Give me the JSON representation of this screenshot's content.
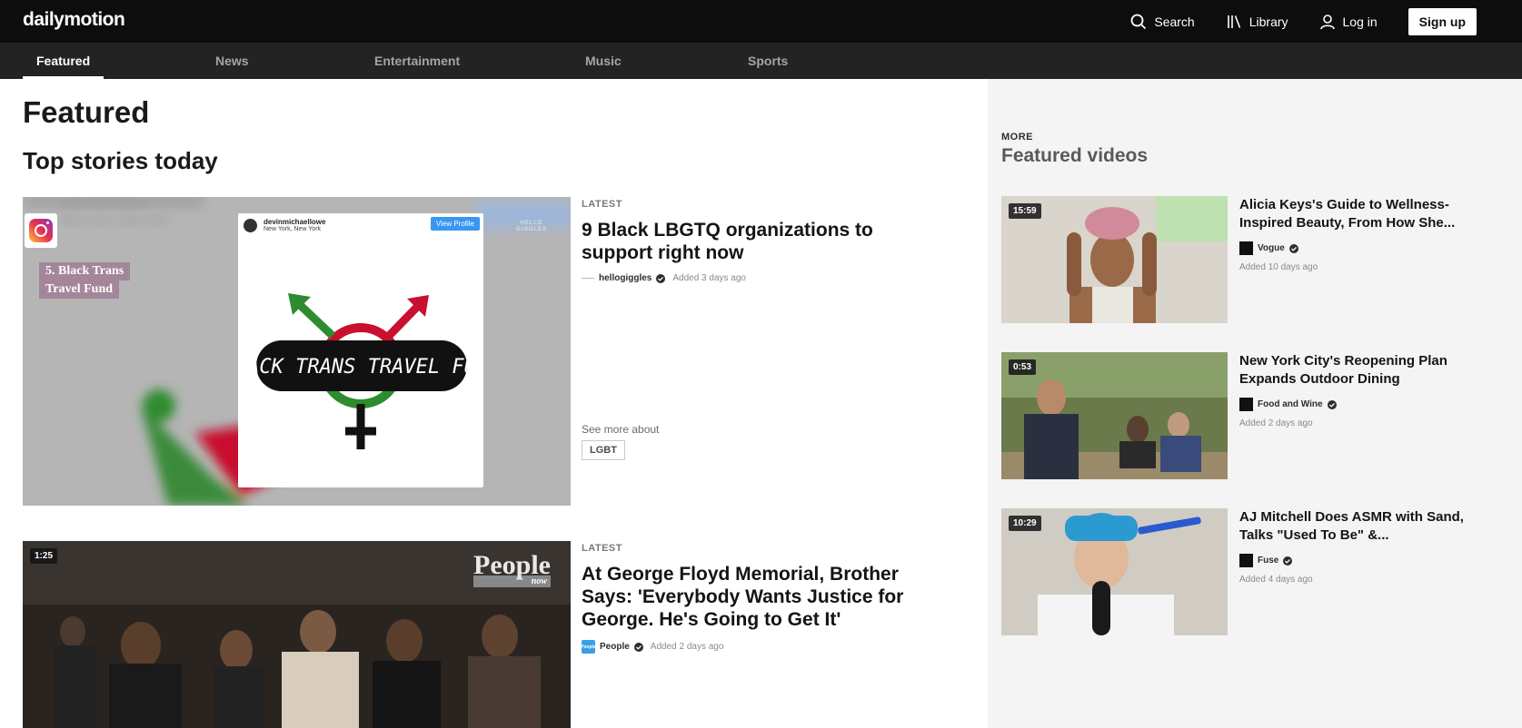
{
  "app": {
    "logo": "dailymotion"
  },
  "header": {
    "search_label": "Search",
    "library_label": "Library",
    "login_label": "Log in",
    "signup_label": "Sign up"
  },
  "nav": {
    "tabs": [
      {
        "label": "Featured",
        "active": true
      },
      {
        "label": "News"
      },
      {
        "label": "Entertainment"
      },
      {
        "label": "Music"
      },
      {
        "label": "Sports"
      }
    ]
  },
  "main": {
    "page_title": "Featured",
    "section_title": "Top stories today",
    "stories": [
      {
        "eyebrow": "LATEST",
        "title": "9 Black LBGTQ organizations to support right now",
        "channel": "hellogiggles",
        "added": "Added 3 days ago",
        "see_more": "See more about",
        "tag": "LGBT",
        "thumb": {
          "caption_line1": "5. Black Trans",
          "caption_line2": "Travel Fund",
          "profile_name": "devinmichaellowe",
          "profile_location": "New York, New York",
          "view_profile": "View Profile",
          "sticker_text": "BLACK TRANS TRAVEL FUND",
          "blurred_name": "devinmichaellowe",
          "blurred_location": "New York, New York",
          "watermark_line1": "HELLO",
          "watermark_line2": "GIGGLES"
        }
      },
      {
        "eyebrow": "LATEST",
        "title": "At George Floyd Memorial, Brother Says: 'Everybody Wants Justice for George. He's Going to Get It'",
        "channel": "People",
        "channel_logo_text": "People",
        "added": "Added 2 days ago",
        "duration": "1:25",
        "brand_watermark": "People",
        "brand_sub": "now"
      }
    ]
  },
  "sidebar": {
    "eyebrow": "MORE",
    "title": "Featured videos",
    "videos": [
      {
        "duration": "15:59",
        "title": "Alicia Keys's Guide to Wellness-Inspired Beauty, From How She...",
        "channel": "Vogue",
        "added": "Added 10 days ago"
      },
      {
        "duration": "0:53",
        "title": "New York City's Reopening Plan Expands Outdoor Dining",
        "channel": "Food and Wine",
        "added": "Added 2 days ago"
      },
      {
        "duration": "10:29",
        "title": "AJ Mitchell Does ASMR with Sand, Talks \"Used To Be\" &...",
        "channel": "Fuse",
        "added": "Added 4 days ago"
      }
    ]
  },
  "colors": {
    "topbar": "#0d0d0d",
    "navbar": "#232323",
    "sidebar_bg": "#f4f4f4",
    "view_profile_blue": "#3897f0",
    "flag_red": "#c8102e",
    "flag_green": "#2e8b2e"
  },
  "icons": {
    "search": "search-icon",
    "library": "library-icon",
    "login": "user-icon",
    "verified": "verified-check-icon",
    "instagram": "instagram-icon"
  }
}
